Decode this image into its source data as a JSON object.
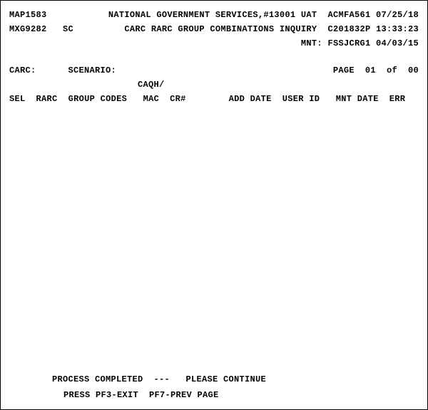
{
  "header": {
    "line1": {
      "map_id": "MAP1583",
      "title": "NATIONAL GOVERNMENT SERVICES,#13001 UAT",
      "sys_id": "ACMFA561",
      "date": "07/25/18"
    },
    "line2": {
      "user_id": "MXG9282",
      "region": "SC",
      "subtitle": "CARC RARC GROUP COMBINATIONS INQUIRY",
      "cycle": "C201832P",
      "time": "13:33:23"
    },
    "line3": {
      "mnt_label": "MNT:",
      "mnt_id": "FSSJCRG1",
      "mnt_date": "04/03/15"
    }
  },
  "params": {
    "carc_label": "CARC:",
    "scenario_label": "SCENARIO:",
    "page_label": "PAGE",
    "page_current": "01",
    "page_of": "of",
    "page_total": "00",
    "caqh": "CAQH/"
  },
  "columns": {
    "sel": "SEL",
    "rarc": "RARC",
    "group_codes": "GROUP CODES",
    "mac": "MAC",
    "cr": "CR#",
    "add_date": "ADD DATE",
    "user_id": "USER ID",
    "mnt_date": "MNT DATE",
    "err": "ERR"
  },
  "footer": {
    "status": "PROCESS COMPLETED  ---   PLEASE CONTINUE",
    "keys": "PRESS PF3-EXIT  PF7-PREV PAGE"
  }
}
